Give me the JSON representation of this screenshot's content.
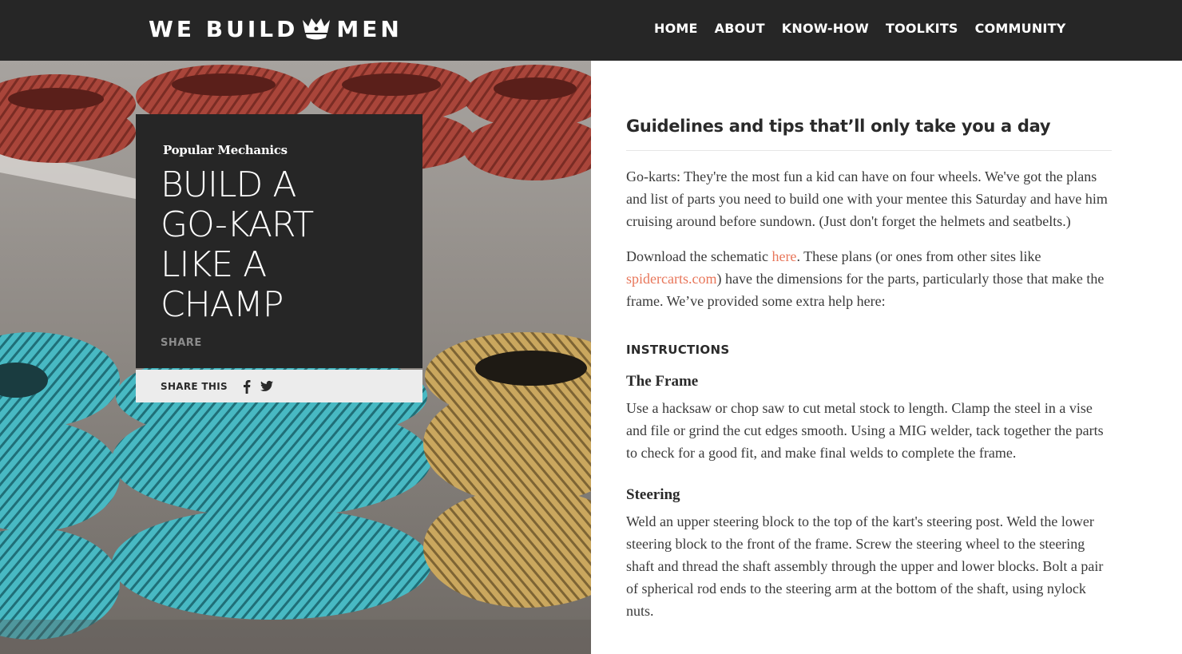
{
  "header": {
    "logo_left": "WE BUILD",
    "logo_right": "MEN",
    "logo_icon": "crown-icon",
    "nav": [
      {
        "label": "HOME"
      },
      {
        "label": "ABOUT"
      },
      {
        "label": "KNOW-HOW"
      },
      {
        "label": "TOOLKITS"
      },
      {
        "label": "COMMUNITY"
      }
    ]
  },
  "hero": {
    "source": "Popular Mechanics",
    "title_lines": [
      "BUILD A",
      "GO-KART",
      "LIKE A",
      "CHAMP"
    ],
    "share_label": "SHARE",
    "share_this": "SHARE THIS",
    "share_icons": [
      "facebook-icon",
      "twitter-icon"
    ]
  },
  "article": {
    "heading": "Guidelines and tips that’ll only take you a day",
    "intro": "Go-karts: They're the most fun a kid can have on four wheels. We've got the plans and list of parts you need to build one with your mentee this Saturday and have him cruising around before sundown. (Just don't forget the helmets and seatbelts.)",
    "download_before": "Download the schematic ",
    "download_link": "here",
    "download_middle": ". These plans (or ones from other sites like ",
    "spider_link": "spidercarts.com",
    "download_after": ") have the dimensions for the parts, particularly those that make the frame. We’ve provided some extra help here:",
    "instructions_heading": "INSTRUCTIONS",
    "sections": [
      {
        "title": "The Frame",
        "body": "Use a hacksaw or chop saw to cut metal stock to length. Clamp the steel in a vise and file or grind the cut edges smooth. Using a MIG welder, tack together the parts to check for a good fit, and make final welds to complete the frame."
      },
      {
        "title": "Steering",
        "body": "Weld an upper steering block to the top of the kart's steering post. Weld the lower steering block to the front of the frame. Screw the steering wheel to the steering shaft and thread the shaft assembly through the upper and lower blocks. Bolt a pair of spherical rod ends to the steering arm at the bottom of the shaft, using nylock nuts."
      }
    ]
  },
  "colors": {
    "header_bg": "#262626",
    "card_bg": "#262626",
    "link": "#e8765a",
    "tire_red": "#b2473c",
    "tire_teal": "#3fb3bd",
    "tire_yellow": "#c9a85a"
  }
}
